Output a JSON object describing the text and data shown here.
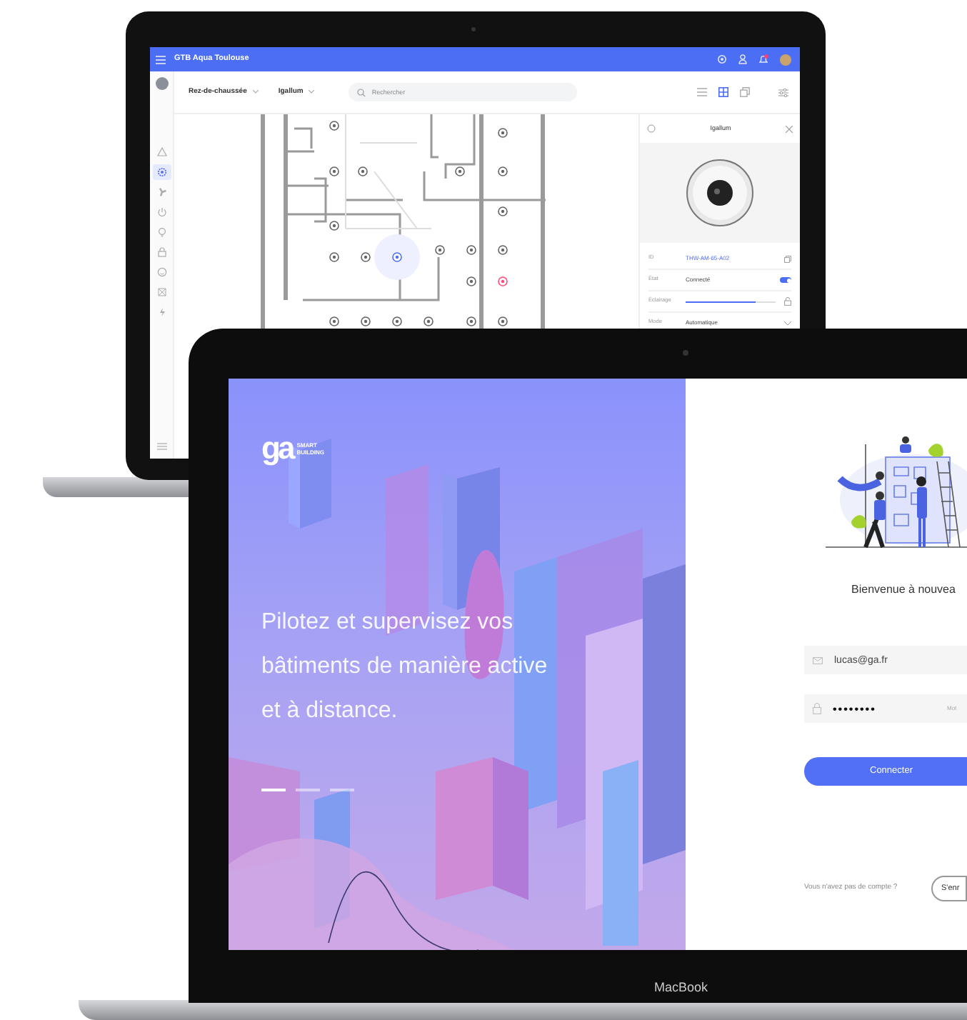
{
  "back_laptop": {
    "app_title": "GTB Aqua Toulouse",
    "top_icons": [
      {
        "kind": "gear"
      },
      {
        "kind": "user"
      },
      {
        "kind": "bell",
        "alert": true
      },
      {
        "kind": "avatar"
      }
    ],
    "sidebar_items": [
      {
        "kind": "warning",
        "selected": false
      },
      {
        "kind": "gear",
        "selected": true
      },
      {
        "kind": "fan",
        "selected": false
      },
      {
        "kind": "power",
        "selected": false
      },
      {
        "kind": "bulb",
        "selected": false
      },
      {
        "kind": "lock",
        "selected": false
      },
      {
        "kind": "smiley",
        "selected": false
      },
      {
        "kind": "network",
        "selected": false
      },
      {
        "kind": "bolt",
        "selected": false
      }
    ],
    "floor_select": "Rez-de-chaussée",
    "device_select": "Igallum",
    "search": {
      "placeholder": "Rechercher"
    },
    "view_buttons": [
      {
        "kind": "list",
        "selected": false
      },
      {
        "kind": "grid",
        "selected": true
      },
      {
        "kind": "copy",
        "selected": false
      }
    ],
    "sensors": [
      {
        "selected": false,
        "alarm": false
      },
      {
        "selected": false,
        "alarm": false
      },
      {
        "selected": false,
        "alarm": false
      },
      {
        "selected": false,
        "alarm": false
      },
      {
        "selected": false,
        "alarm": false
      },
      {
        "selected": false,
        "alarm": false
      },
      {
        "selected": false,
        "alarm": false
      },
      {
        "selected": false,
        "alarm": false
      },
      {
        "selected": false,
        "alarm": false
      },
      {
        "selected": false,
        "alarm": false
      },
      {
        "selected": true,
        "alarm": false
      },
      {
        "selected": false,
        "alarm": false
      },
      {
        "selected": false,
        "alarm": false
      },
      {
        "selected": false,
        "alarm": false
      },
      {
        "selected": false,
        "alarm": false
      },
      {
        "selected": false,
        "alarm": true
      },
      {
        "selected": false,
        "alarm": false
      },
      {
        "selected": false,
        "alarm": false
      },
      {
        "selected": false,
        "alarm": false
      },
      {
        "selected": false,
        "alarm": false
      },
      {
        "selected": false,
        "alarm": false
      },
      {
        "selected": false,
        "alarm": false
      }
    ],
    "detail_panel": {
      "title": "Igallum",
      "rows": [
        {
          "kind": "link",
          "label": "ID",
          "value": "THW-AM-65-A02"
        },
        {
          "kind": "toggle",
          "label": "État",
          "value": "Connecté",
          "on": true
        },
        {
          "kind": "slider",
          "label": "Éclairage",
          "level": 0.78
        },
        {
          "kind": "select",
          "label": "Mode",
          "value": "Automatique"
        }
      ]
    }
  },
  "front_laptop": {
    "logo_mark": "ga",
    "logo_lines": [
      "SMART",
      "BUILDING"
    ],
    "tagline_lines": [
      "Pilotez et supervisez vos",
      "bâtiments de manière active",
      "et à distance."
    ],
    "carousel_dots": [
      {
        "selected": true
      },
      {
        "selected": false
      },
      {
        "selected": false
      }
    ],
    "welcome": "Bienvenue à nouvea",
    "email": {
      "value": "lucas@ga.fr"
    },
    "password": {
      "value": "••••••••",
      "hint": "Mot"
    },
    "login_button": "Connecter",
    "signup_prompt": "Vous n'avez pas de compte ?",
    "signup_button": "S'enr",
    "brand_label": "MacBook"
  }
}
